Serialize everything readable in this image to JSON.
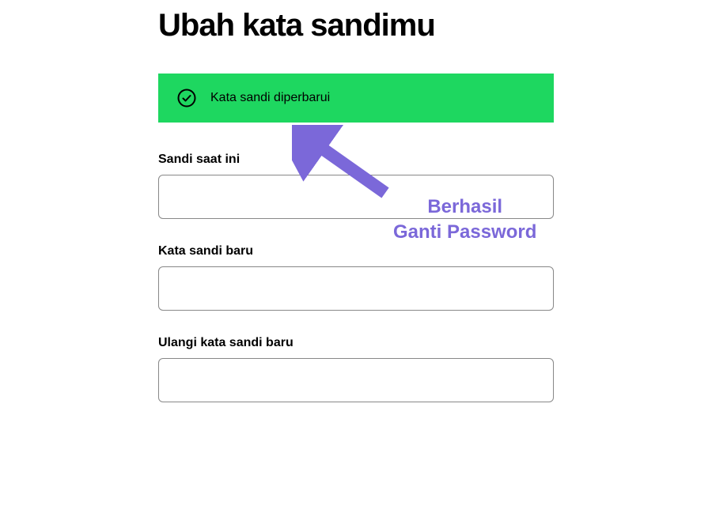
{
  "page": {
    "title": "Ubah kata sandimu"
  },
  "banner": {
    "message": "Kata sandi diperbarui",
    "icon": "check-circle-icon",
    "color": "#1ed760"
  },
  "form": {
    "current_password": {
      "label": "Sandi saat ini",
      "value": ""
    },
    "new_password": {
      "label": "Kata sandi baru",
      "value": ""
    },
    "repeat_password": {
      "label": "Ulangi kata sandi baru",
      "value": ""
    }
  },
  "annotation": {
    "line1": "Berhasil",
    "line2": "Ganti Password",
    "color": "#7b68d9"
  }
}
